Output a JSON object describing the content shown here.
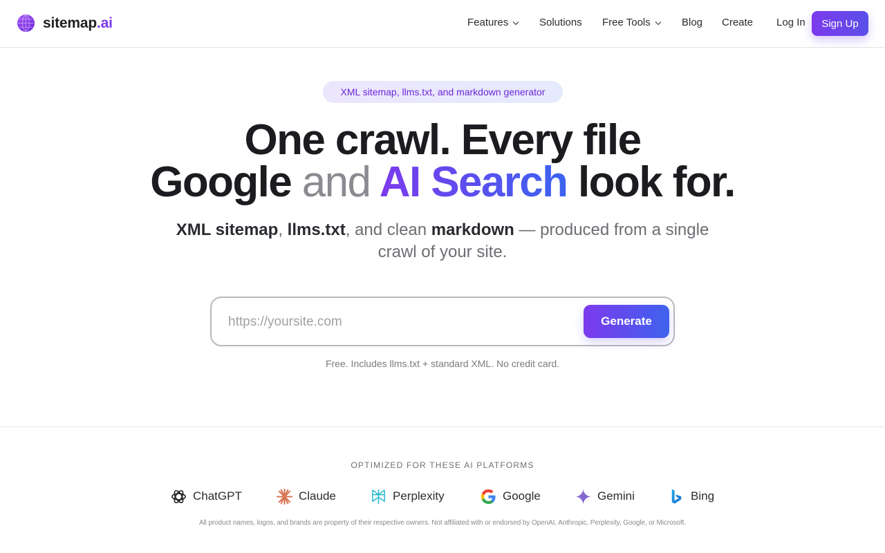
{
  "brand": {
    "name": "sitemap",
    "suffix": ".ai",
    "accent_color": "#7c3aed"
  },
  "nav": {
    "features": "Features",
    "solutions": "Solutions",
    "free_tools": "Free Tools",
    "blog": "Blog",
    "create": "Create",
    "login": "Log In",
    "signup": "Sign Up"
  },
  "hero": {
    "pill": "XML sitemap, llms.txt, and markdown generator",
    "headline_line1": "One crawl. Every file",
    "headline_google": "Google",
    "headline_and": "and",
    "headline_ai": "AI Search",
    "headline_end": "look for.",
    "sub_xml": "XML sitemap",
    "sub_comma1": ",",
    "sub_llms": "llms.txt",
    "sub_mid": ", and clean",
    "sub_md": "markdown",
    "sub_end": "— produced from a single crawl of your site."
  },
  "form": {
    "placeholder": "https://yoursite.com",
    "value": "",
    "button": "Generate",
    "fineprint": "Free. Includes llms.txt + standard XML. No credit card."
  },
  "platforms": {
    "title": "OPTIMIZED FOR THESE AI PLATFORMS",
    "items": [
      {
        "name": "ChatGPT",
        "icon": "chatgpt-icon"
      },
      {
        "name": "Claude",
        "icon": "claude-icon"
      },
      {
        "name": "Perplexity",
        "icon": "perplexity-icon"
      },
      {
        "name": "Google",
        "icon": "google-icon"
      },
      {
        "name": "Gemini",
        "icon": "gemini-icon"
      },
      {
        "name": "Bing",
        "icon": "bing-icon"
      }
    ],
    "disclaimer": "All product names, logos, and brands are property of their respective owners. Not affiliated with or endorsed by OpenAI, Anthropic, Perplexity, Google, or Microsoft."
  }
}
